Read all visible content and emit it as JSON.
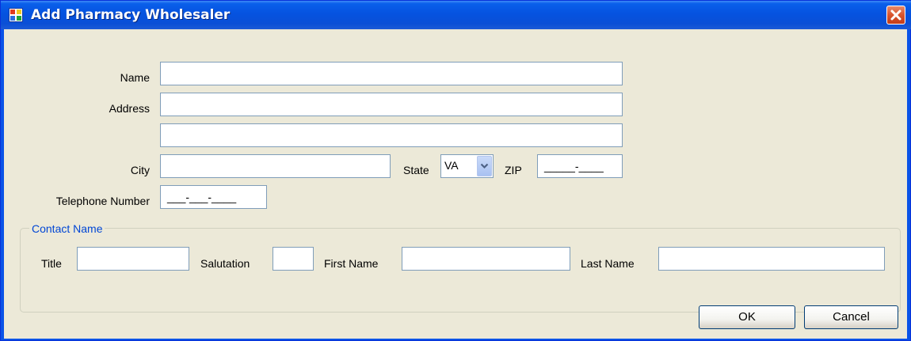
{
  "window": {
    "title": "Add Pharmacy Wholesaler"
  },
  "form": {
    "name_label": "Name",
    "address_label": "Address",
    "city_label": "City",
    "state_label": "State",
    "state_value": "VA",
    "zip_label": "ZIP",
    "zip_mask": "_____-____",
    "telephone_label": "Telephone Number",
    "telephone_mask": "___-___-____"
  },
  "contact": {
    "group_label": "Contact Name",
    "title_label": "Title",
    "salutation_label": "Salutation",
    "first_name_label": "First Name",
    "last_name_label": "Last Name"
  },
  "buttons": {
    "ok": "OK",
    "cancel": "Cancel"
  }
}
